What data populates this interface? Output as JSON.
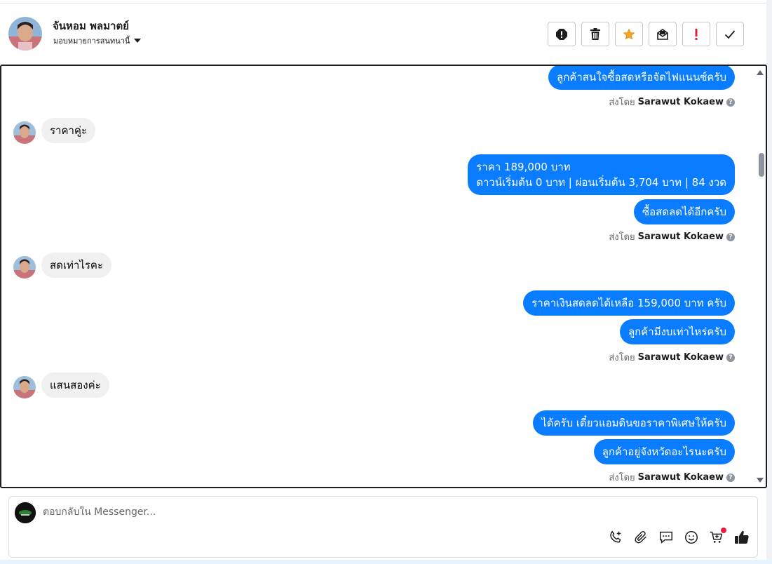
{
  "header": {
    "contact_name": "จันหอม พลมาตย์",
    "assign_label": "มอบหมายการสนทนานี้",
    "actions": [
      {
        "name": "report-spam-button",
        "icon": "alert-circle-icon"
      },
      {
        "name": "delete-button",
        "icon": "trash-icon"
      },
      {
        "name": "star-button",
        "icon": "star-icon"
      },
      {
        "name": "mark-unread-button",
        "icon": "envelope-icon"
      },
      {
        "name": "follow-up-button",
        "icon": "exclamation-icon"
      },
      {
        "name": "mark-done-button",
        "icon": "checkmark-icon"
      }
    ]
  },
  "conversation": {
    "sent_by_prefix": "ส่งโดย",
    "sender_name": "Sarawut Kokaew",
    "messages": {
      "m1": "ลูกค้าสนใจซื้อสดหรือจัดไฟแนนซ์ครับ",
      "m2": "ราคาคู่ะ",
      "m3_line1": "ราคา 189,000 บาท",
      "m3_line2": "ดาวน์เริ่มต้น 0 บาท | ผ่อนเริ่มต้น 3,704 บาท | 84 งวด",
      "m4": "ซื้อสดลดได้อีกครับ",
      "m5": "สดเท่าไรคะ",
      "m6": "ราคาเงินสดลดได้เหลือ 159,000 บาท ครับ",
      "m7": "ลูกค้ามีงบเท่าไหร่ครับ",
      "m8": "แสนสองค่ะ",
      "m9": "ได้ครับ เดี๋ยวแอมดินขอราคาพิเศษให้ครับ",
      "m10": "ลูกค้าอยู่จังหวัดอะไรนะครับ"
    }
  },
  "composer": {
    "placeholder": "ตอบกลับใน Messenger...",
    "value": "",
    "tools": [
      "phone-plus-icon",
      "paperclip-icon",
      "saved-reply-icon",
      "emoji-icon",
      "cart-icon",
      "thumbs-up-icon"
    ]
  },
  "colors": {
    "outgoing_bubble": "#0a7cff",
    "incoming_bubble": "#f0f0f0",
    "star": "#f5a623",
    "alert_red": "#e41e3f"
  }
}
